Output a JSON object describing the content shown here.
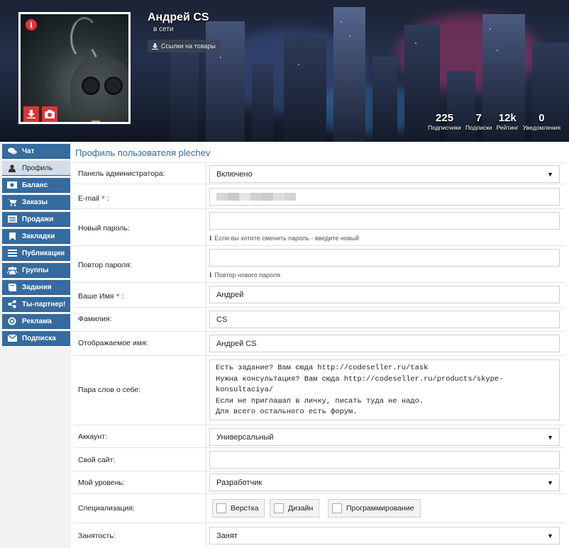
{
  "header": {
    "user_name": "Андрей CS",
    "status": "в сети",
    "links_button": "Ссылки на товары",
    "stats": [
      {
        "value": "225",
        "label": "Подписчики"
      },
      {
        "value": "7",
        "label": "Подписки"
      },
      {
        "value": "12k",
        "label": "Рейтинг"
      },
      {
        "value": "0",
        "label": "Уведомления"
      }
    ]
  },
  "sidebar": {
    "items": [
      {
        "label": "Чат",
        "icon": "chat-icon"
      },
      {
        "label": "Профиль",
        "icon": "user-icon",
        "active": true
      },
      {
        "label": "Баланс",
        "icon": "money-icon"
      },
      {
        "label": "Заказы",
        "icon": "cart-icon"
      },
      {
        "label": "Продажи",
        "icon": "sales-icon"
      },
      {
        "label": "Закладки",
        "icon": "bookmark-icon"
      },
      {
        "label": "Публикации",
        "icon": "list-icon"
      },
      {
        "label": "Группы",
        "icon": "group-icon"
      },
      {
        "label": "Задания",
        "icon": "book-icon"
      },
      {
        "label": "Ты-партнер!",
        "icon": "share-icon"
      },
      {
        "label": "Реклама",
        "icon": "target-icon"
      },
      {
        "label": "Подписка",
        "icon": "mail-icon"
      }
    ]
  },
  "page_title": "Профиль пользователя plechev",
  "form": {
    "admin_panel": {
      "label": "Панель администратора:",
      "value": "Включено"
    },
    "email": {
      "label": "E-mail",
      "suffix": ":",
      "value": ""
    },
    "new_password": {
      "label": "Новый пароль:",
      "hint": "Если вы хотите сменить пароль - введите новый"
    },
    "repeat_password": {
      "label": "Повтор пароля:",
      "hint": "Повтор нового пароля"
    },
    "first_name": {
      "label": "Ваше Имя",
      "suffix": ":",
      "value": "Андрей"
    },
    "last_name": {
      "label": "Фамилия:",
      "value": "CS"
    },
    "display_name": {
      "label": "Отображаемое имя:",
      "value": "Андрей CS"
    },
    "about": {
      "label": "Пара слов о себе:",
      "value": "Есть задание? Вам сюда http://codeseller.ru/task\nНужна консультация? Вам сюда http://codeseller.ru/products/skype-\nkonsultaciya/\nЕсли не приглашал в личку, писать туда не надо.\nДля всего остального есть форум."
    },
    "account": {
      "label": "Аккаунт:",
      "value": "Универсальный"
    },
    "website": {
      "label": "Свой сайт:",
      "value": ""
    },
    "level": {
      "label": "Мой уровень:",
      "value": "Разработчик"
    },
    "specialization": {
      "label": "Специализация:",
      "options": [
        "Верстка",
        "Дизайн",
        "Программирование"
      ]
    },
    "employment": {
      "label": "Занятость:",
      "value": "Занят"
    }
  },
  "colors": {
    "accent": "#356b9e",
    "required": "#d9363a",
    "sidebar_active": "#d3dde8"
  }
}
